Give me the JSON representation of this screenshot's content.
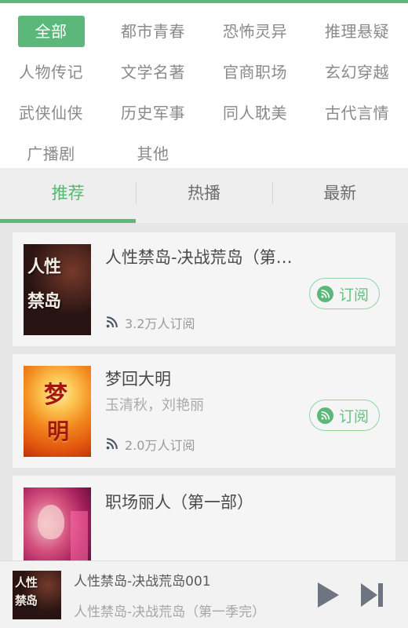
{
  "theme": {
    "accent": "#5cb87a",
    "accent_text": "#52b970",
    "page_bg": "#e6e6e6",
    "card_bg": "#f5f5f5",
    "tabbar_bg": "#eeeeee",
    "muted_text": "#8a8a8a",
    "title_text": "#4a4a4a",
    "player_bg": "#f2f2f2",
    "control_icon": "#6e7480",
    "rss_icon": "#4c5566"
  },
  "categories": {
    "rows": [
      [
        {
          "label": "全部",
          "active": true
        },
        {
          "label": "都市青春",
          "active": false
        },
        {
          "label": "恐怖灵异",
          "active": false
        },
        {
          "label": "推理悬疑",
          "active": false
        }
      ],
      [
        {
          "label": "人物传记",
          "active": false
        },
        {
          "label": "文学名著",
          "active": false
        },
        {
          "label": "官商职场",
          "active": false
        },
        {
          "label": "玄幻穿越",
          "active": false
        }
      ],
      [
        {
          "label": "武侠仙侠",
          "active": false
        },
        {
          "label": "历史军事",
          "active": false
        },
        {
          "label": "同人耽美",
          "active": false
        },
        {
          "label": "古代言情",
          "active": false
        }
      ],
      [
        {
          "label": "广播剧",
          "active": false
        },
        {
          "label": "其他",
          "active": false
        },
        {
          "label": "",
          "active": false
        },
        {
          "label": "",
          "active": false
        }
      ]
    ]
  },
  "tabs": [
    {
      "label": "推荐",
      "active": true
    },
    {
      "label": "热播",
      "active": false
    },
    {
      "label": "最新",
      "active": false
    }
  ],
  "list": {
    "items": [
      {
        "title": "人性禁岛-决战荒岛（第…",
        "author": "",
        "subscriber_count": "3.2万人订阅",
        "subscribe_label": "订阅",
        "cover_icon": "book-cover-renxingjindao",
        "rss_icon": "rss-icon",
        "subscribe_icon": "rss-circle-icon"
      },
      {
        "title": "梦回大明",
        "author": "玉清秋，刘艳丽",
        "subscriber_count": "2.0万人订阅",
        "subscribe_label": "订阅",
        "cover_icon": "book-cover-menghuidaming",
        "rss_icon": "rss-icon",
        "subscribe_icon": "rss-circle-icon"
      },
      {
        "title": "职场丽人（第一部）",
        "author": "",
        "subscriber_count": "",
        "subscribe_label": "",
        "cover_icon": "book-cover-zhichangliren",
        "rss_icon": "rss-icon",
        "subscribe_icon": "rss-circle-icon"
      }
    ]
  },
  "player": {
    "thumb_icon": "now-playing-cover",
    "title": "人性禁岛-决战荒岛001",
    "subtitle": "人性禁岛-决战荒岛（第一季完）",
    "play_icon": "play-icon",
    "next_icon": "next-track-icon"
  }
}
